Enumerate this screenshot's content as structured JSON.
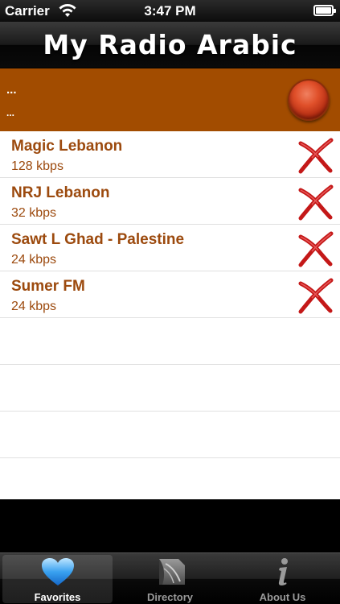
{
  "status_bar": {
    "carrier": "Carrier",
    "time": "3:47 PM",
    "wifi_icon": "wifi-icon",
    "battery_icon": "battery-icon"
  },
  "header": {
    "title": "My Radio Arabic"
  },
  "now_playing": {
    "line1": "...",
    "line2": "...",
    "play_icon": "play-button-icon"
  },
  "colors": {
    "accent": "#a24c00",
    "station_text": "#9c4a0e",
    "delete": "#c41818"
  },
  "stations": [
    {
      "name": "Magic Lebanon",
      "bitrate": "128 kbps"
    },
    {
      "name": "NRJ Lebanon",
      "bitrate": "32 kbps"
    },
    {
      "name": "Sawt L Ghad - Palestine",
      "bitrate": "24 kbps"
    },
    {
      "name": "Sumer FM",
      "bitrate": "24 kbps"
    }
  ],
  "tabs": [
    {
      "label": "Favorites",
      "icon": "heart-icon",
      "selected": true
    },
    {
      "label": "Directory",
      "icon": "directory-icon",
      "selected": false
    },
    {
      "label": "About Us",
      "icon": "info-icon",
      "selected": false
    }
  ]
}
